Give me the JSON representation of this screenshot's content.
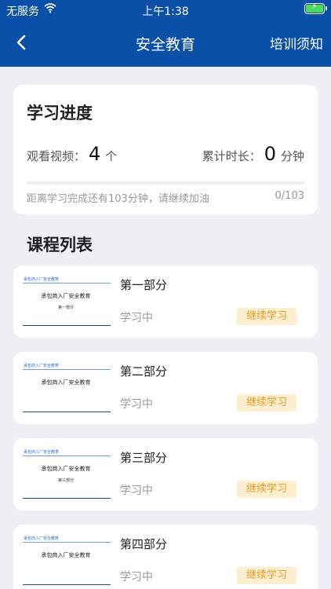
{
  "status_bar": {
    "carrier": "无服务",
    "time": "上午1:38"
  },
  "nav": {
    "title": "安全教育",
    "right_action": "培训须知"
  },
  "progress": {
    "title": "学习进度",
    "videos_label": "观看视频：",
    "videos_value": "4",
    "videos_unit": "个",
    "duration_label": "累计时长：",
    "duration_value": "0",
    "duration_unit": "分钟",
    "hint": "距离学习完成还有103分钟，请继续加油",
    "count": "0/103",
    "fraction": 0
  },
  "course_list": {
    "title": "课程列表",
    "items": [
      {
        "name": "第一部分",
        "status": "学习中",
        "action": "继续学习",
        "thumb": {
          "tag": "承包商入厂安全教育",
          "heading": "承包商入厂安全教育",
          "sub": "第一部分"
        }
      },
      {
        "name": "第二部分",
        "status": "学习中",
        "action": "继续学习",
        "thumb": {
          "tag": "承包商入厂安全教育",
          "heading": "承包商入厂安全教育",
          "sub": ""
        }
      },
      {
        "name": "第三部分",
        "status": "学习中",
        "action": "继续学习",
        "thumb": {
          "tag": "承包商入厂安全教育",
          "heading": "承包商入厂安全教育",
          "sub": "第三部分"
        }
      },
      {
        "name": "第四部分",
        "status": "学习中",
        "action": "继续学习",
        "thumb": {
          "tag": "承包商入厂安全教育",
          "heading": "承包商入厂安全教育",
          "sub": ""
        }
      }
    ]
  },
  "colors": {
    "primary": "#0a50a8",
    "accent": "#e89a24",
    "accent_bg": "#fdefcf",
    "background": "#eef0f4"
  },
  "icons": {
    "back": "chevron-left-icon",
    "wifi": "wifi-icon",
    "battery": "battery-charging-icon"
  }
}
